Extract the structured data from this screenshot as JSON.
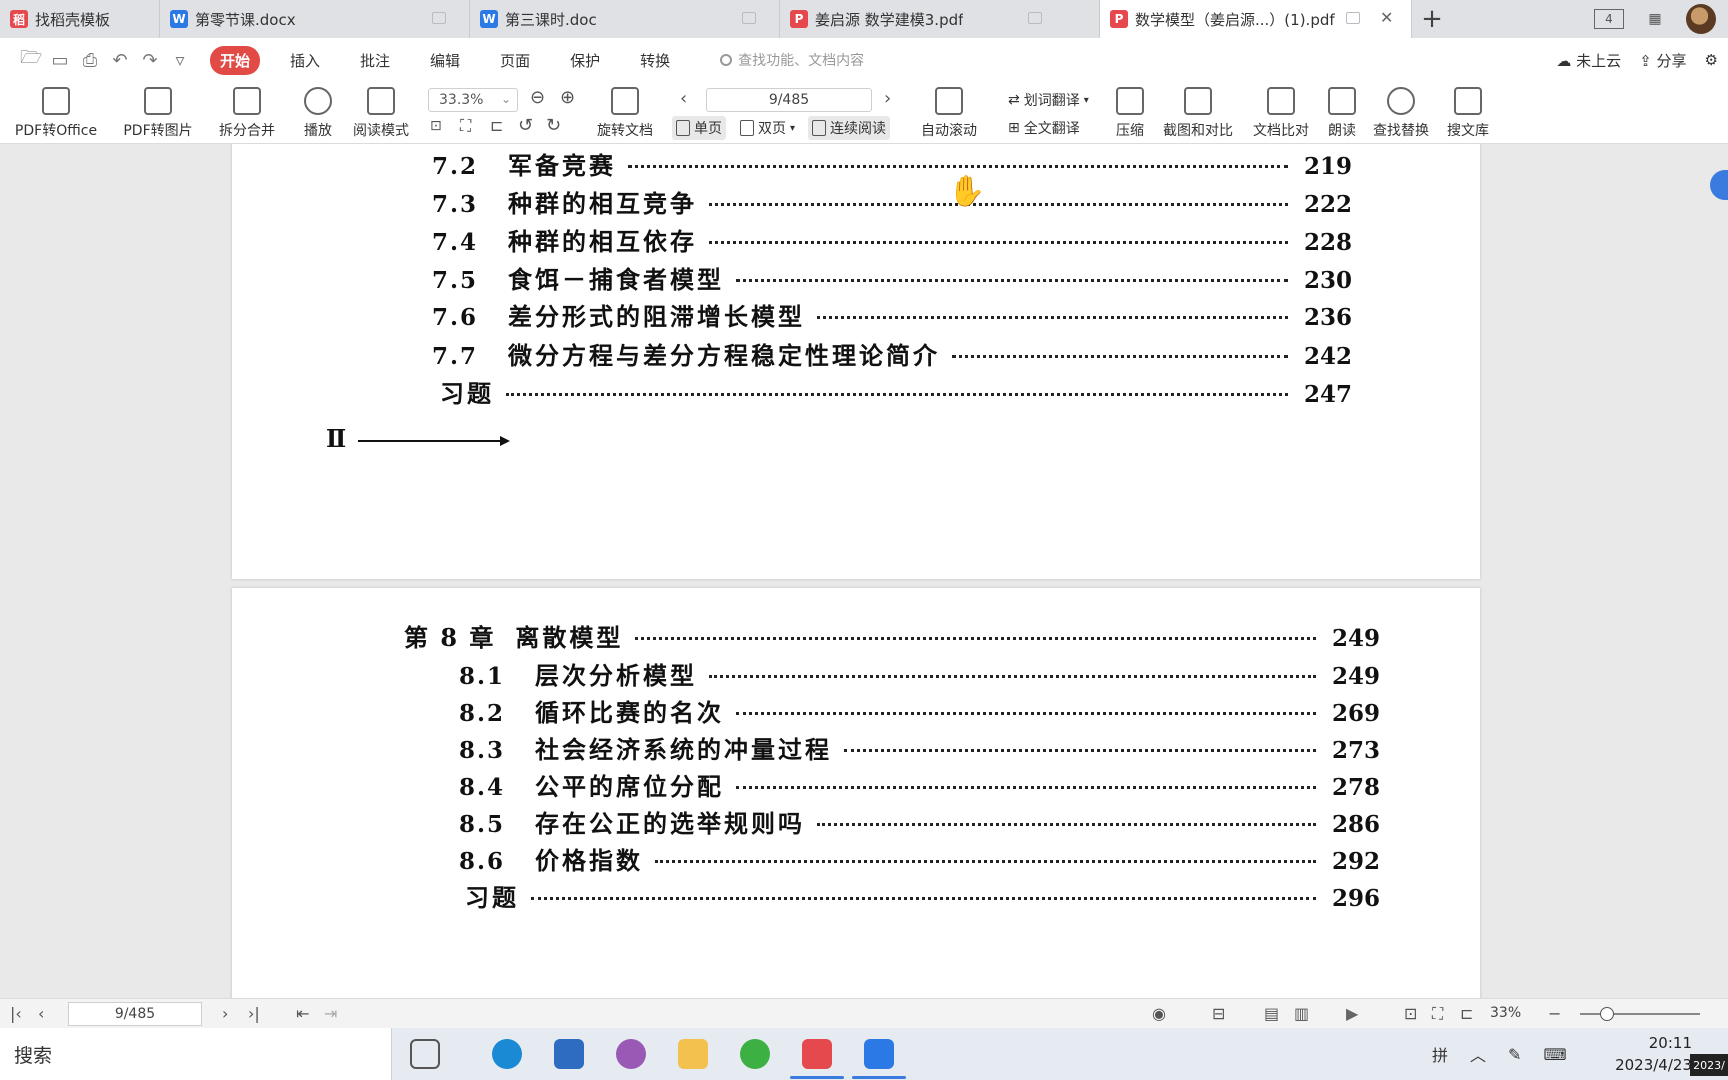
{
  "tabs": [
    {
      "label": "找稻壳模板",
      "icon": "docer-icon",
      "color": "#e5484d"
    },
    {
      "label": "第零节课.docx",
      "icon": "word-icon",
      "color": "#2b79e4"
    },
    {
      "label": "第三课时.doc",
      "icon": "word-icon",
      "color": "#2b79e4"
    },
    {
      "label": "姜启源 数学建模3.pdf",
      "icon": "pdf-icon",
      "color": "#e5484d"
    },
    {
      "label": "数学模型（姜启源...）(1).pdf",
      "icon": "pdf-icon",
      "color": "#e5484d",
      "active": true
    }
  ],
  "tabbar_right": {
    "window_count": "4"
  },
  "menu": {
    "items": [
      "开始",
      "插入",
      "批注",
      "编辑",
      "页面",
      "保护",
      "转换"
    ],
    "active": "开始",
    "search_placeholder": "查找功能、文档内容",
    "cloud": "未上云",
    "share": "分享"
  },
  "ribbon": {
    "pdf_to_office": "PDF转Office",
    "pdf_to_image": "PDF转图片",
    "split_merge": "拆分合并",
    "play": "播放",
    "read_mode": "阅读模式",
    "zoom": "33.3%",
    "rotate": "旋转文档",
    "page": "9/485",
    "single": "单页",
    "double": "双页",
    "continuous": "连续阅读",
    "auto_scroll": "自动滚动",
    "word_translate": "划词翻译",
    "full_translate": "全文翻译",
    "compress": "压缩",
    "screenshot_compare": "截图和对比",
    "doc_compare": "文档比对",
    "read_aloud": "朗读",
    "find_replace": "查找替换",
    "search_library": "搜文库"
  },
  "page1_entries": [
    {
      "num": "7.2",
      "title": "军备竞赛",
      "page": "219"
    },
    {
      "num": "7.3",
      "title": "种群的相互竞争",
      "page": "222"
    },
    {
      "num": "7.4",
      "title": "种群的相互依存",
      "page": "228"
    },
    {
      "num": "7.5",
      "title": "食饵－捕食者模型",
      "page": "230"
    },
    {
      "num": "7.6",
      "title": "差分形式的阻滞增长模型",
      "page": "236"
    },
    {
      "num": "7.7",
      "title": "微分方程与差分方程稳定性理论简介",
      "page": "242"
    },
    {
      "num": "",
      "title": "习题",
      "page": "247"
    }
  ],
  "page1_mark": "Ⅱ",
  "page2_chapter": {
    "label": "第 8 章",
    "title": "离散模型",
    "page": "249"
  },
  "page2_entries": [
    {
      "num": "8.1",
      "title": "层次分析模型",
      "page": "249"
    },
    {
      "num": "8.2",
      "title": "循环比赛的名次",
      "page": "269"
    },
    {
      "num": "8.3",
      "title": "社会经济系统的冲量过程",
      "page": "273"
    },
    {
      "num": "8.4",
      "title": "公平的席位分配",
      "page": "278"
    },
    {
      "num": "8.5",
      "title": "存在公正的选举规则吗",
      "page": "286"
    },
    {
      "num": "8.6",
      "title": "价格指数",
      "page": "292"
    },
    {
      "num": "",
      "title": "习题",
      "page": "296"
    }
  ],
  "statusbar": {
    "page": "9/485",
    "zoom": "33%"
  },
  "taskbar": {
    "search": "搜索",
    "ime": "拼",
    "time": "20:11",
    "date": "2023/4/23",
    "notification": "2023/"
  }
}
